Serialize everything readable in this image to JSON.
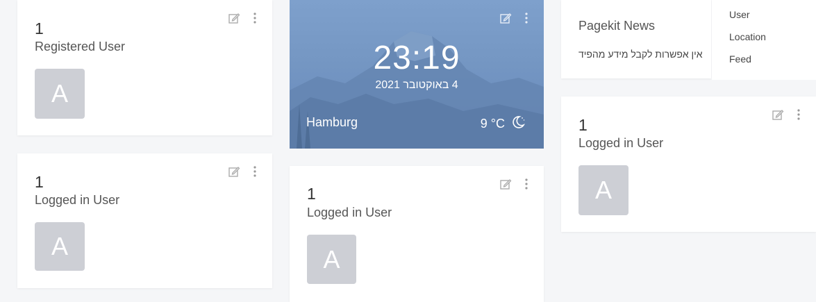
{
  "widgets": {
    "registered": {
      "count": "1",
      "label": "Registered User",
      "avatar": "A"
    },
    "logged_left": {
      "count": "1",
      "label": "Logged in User",
      "avatar": "A"
    },
    "logged_mid": {
      "count": "1",
      "label": "Logged in User",
      "avatar": "A"
    },
    "logged_right": {
      "count": "1",
      "label": "Logged in User",
      "avatar": "A"
    }
  },
  "weather": {
    "time": "23:19",
    "date": "4 באוקטובר 2021",
    "city": "Hamburg",
    "temperature": "9 °C"
  },
  "news": {
    "title": "Pagekit News",
    "message": "אין אפשרות לקבל מידע מהפיד"
  },
  "side_menu": {
    "items": [
      "User",
      "Location",
      "Feed"
    ]
  },
  "icons": {
    "edit": "pencil-square-icon",
    "more": "vertical-dots-icon",
    "weather": "moon-icon"
  }
}
